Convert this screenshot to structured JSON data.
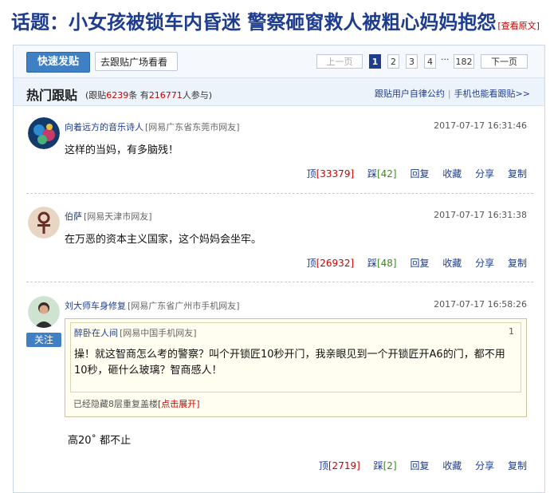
{
  "topic": {
    "prefix": "话题：",
    "title": "小女孩被锁车内昏迷 警察砸窗救人被粗心妈妈抱怨",
    "source_link": "[查看原文]"
  },
  "toolbar": {
    "quick_post": "快速发贴",
    "goto_square": "去跟贴广场看看",
    "goto_arrow": "〉"
  },
  "pagination": {
    "prev": "上一页",
    "pages": [
      "1",
      "2",
      "3",
      "4"
    ],
    "ellipsis": "···",
    "last": "182",
    "next": "下一页",
    "current": "1"
  },
  "hot": {
    "title": "热门跟贴",
    "stats_prefix": "(跟贴",
    "count": "6239",
    "stats_mid": "条 有",
    "participants": "216771",
    "stats_suffix": "人参与)",
    "link_rules": "跟贴用户自律公约",
    "link_sep": "|",
    "link_mobile": "手机也能看跟贴>>"
  },
  "posts": [
    {
      "author": "向着远方的音乐诗人",
      "location": "[网易广东省东莞市网友]",
      "time": "2017-07-17 16:31:46",
      "content": "这样的当妈，有多脑残！",
      "up_label": "顶",
      "up_count": "[33379]",
      "down_label": "踩",
      "down_count": "[42]",
      "reply": "回复",
      "fav": "收藏",
      "share": "分享",
      "copy": "复制"
    },
    {
      "author": "伯萨",
      "location": "[网易天津市网友]",
      "time": "2017-07-17 16:31:38",
      "content": "在万恶的资本主义国家，这个妈妈会坐牢。",
      "up_label": "顶",
      "up_count": "[26932]",
      "down_label": "踩",
      "down_count": "[48]",
      "reply": "回复",
      "fav": "收藏",
      "share": "分享",
      "copy": "复制"
    },
    {
      "author": "刘大师车身修复",
      "location": "[网易广东省广州市手机网友]",
      "time": "2017-07-17 16:58:26",
      "follow": "关注",
      "quote": {
        "author": "醉卧在人间",
        "location": "[网易中国手机网友]",
        "floor": "1",
        "text": "操！就这智商怎么考的警察？叫个开锁匠10秒开门，我亲眼见到一个开锁匠开A6的门，都不用10秒，砸什么玻璃？智商感人！",
        "hidden_text": "已经隐藏8层重复盖楼",
        "expand": "[点击展开]"
      },
      "content": "高20˚ 都不止",
      "up_label": "顶",
      "up_count": "[2719]",
      "down_label": "踩",
      "down_count": "[2]",
      "reply": "回复",
      "fav": "收藏",
      "share": "分享",
      "copy": "复制"
    }
  ]
}
